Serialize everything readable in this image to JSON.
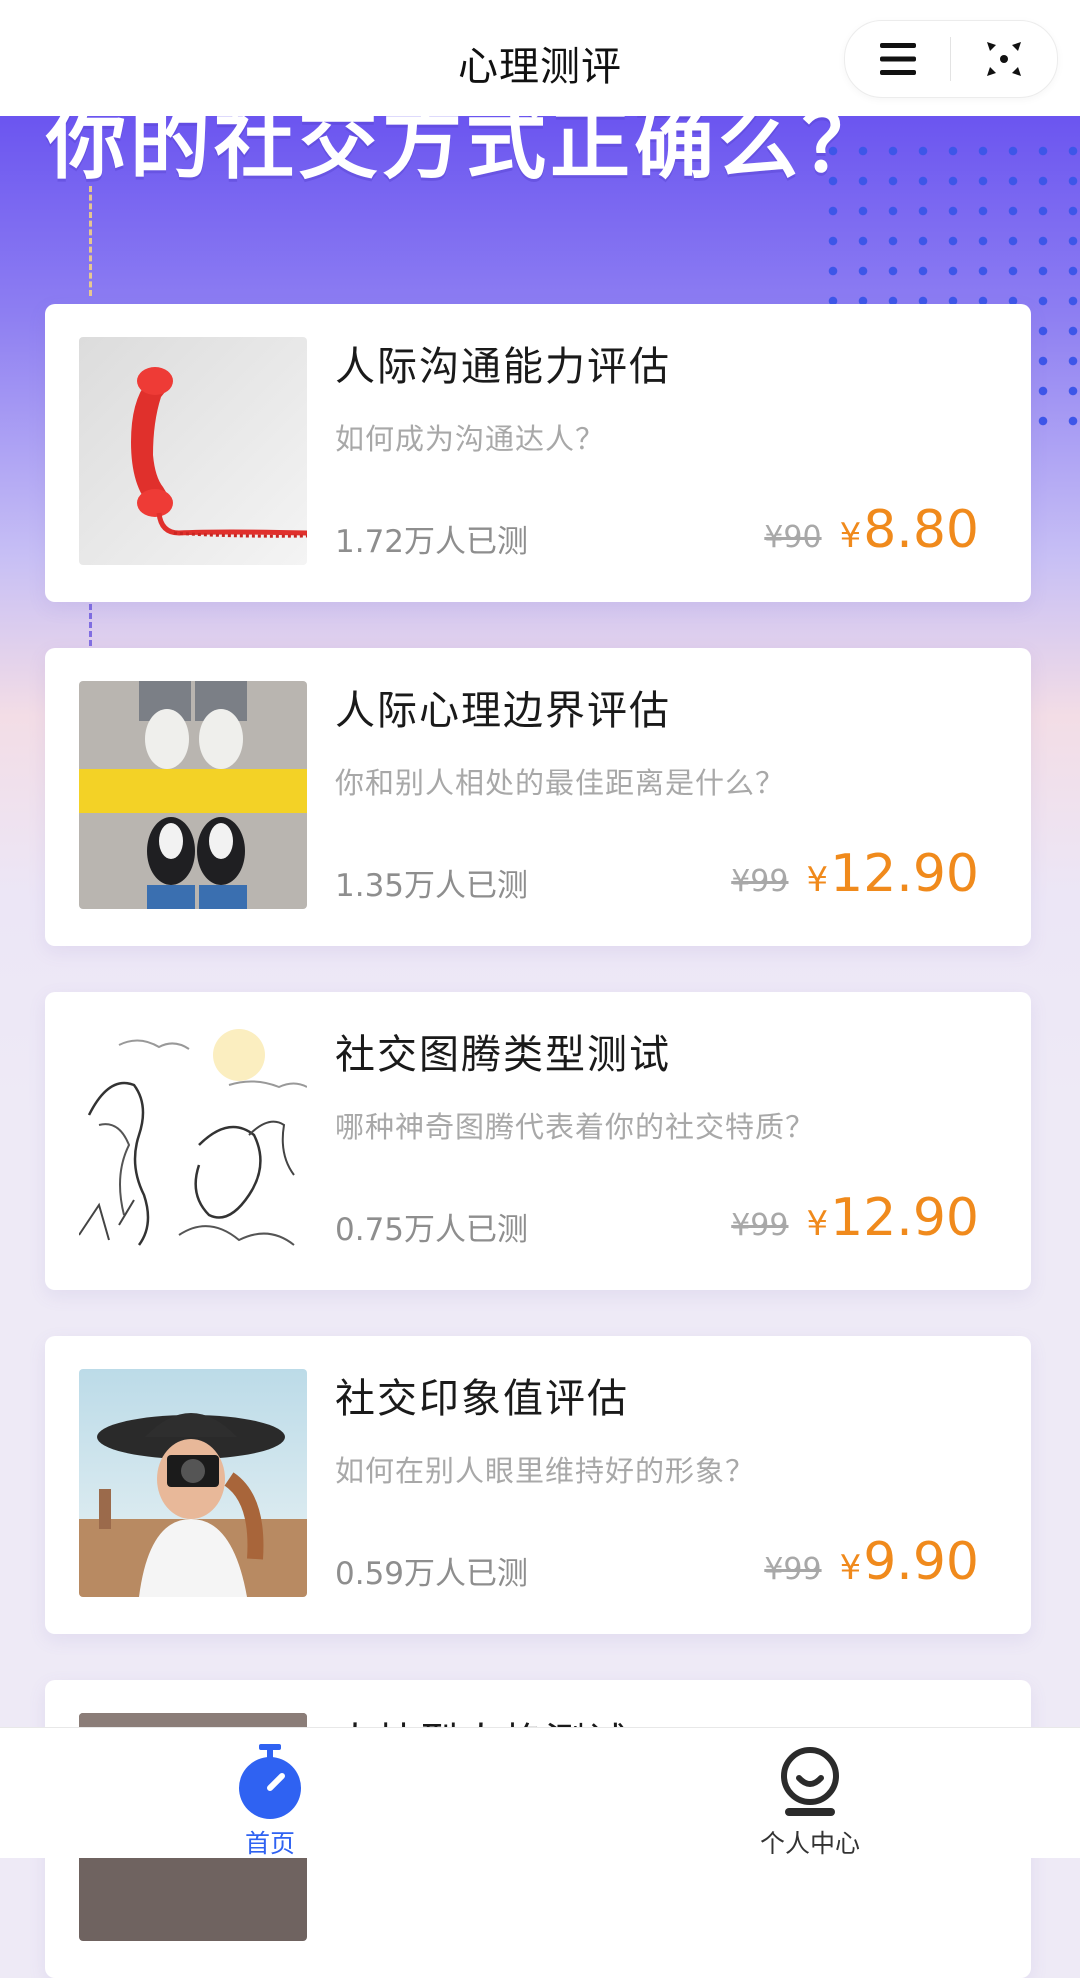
{
  "header": {
    "title": "心理测评",
    "menu_icon": "hamburger-menu-icon",
    "close_icon": "close-target-icon"
  },
  "hero": {
    "title": "你的社交方式正确么？"
  },
  "cards": [
    {
      "title": "人际沟通能力评估",
      "subtitle": "如何成为沟通达人？",
      "count": "1.72万人已测",
      "old_price": "¥90",
      "new_price_symbol": "¥",
      "new_price": "8.80",
      "image": "red-telephone-handset"
    },
    {
      "title": "人际心理边界评估",
      "subtitle": "你和别人相处的最佳距离是什么？",
      "count": "1.35万人已测",
      "old_price": "¥99",
      "new_price_symbol": "¥",
      "new_price": "12.90",
      "image": "shoes-yellow-line"
    },
    {
      "title": "社交图腾类型测试",
      "subtitle": "哪种神奇图腾代表着你的社交特质？",
      "count": "0.75万人已测",
      "old_price": "¥99",
      "new_price_symbol": "¥",
      "new_price": "12.90",
      "image": "dragon-phoenix-sketch"
    },
    {
      "title": "社交印象值评估",
      "subtitle": "如何在别人眼里维持好的形象？",
      "count": "0.59万人已测",
      "old_price": "¥99",
      "new_price_symbol": "¥",
      "new_price": "9.90",
      "image": "woman-with-camera"
    },
    {
      "title": "大扶型人格测试",
      "subtitle": "",
      "count": "",
      "old_price": "",
      "new_price_symbol": "",
      "new_price": "",
      "image": "partial-photo"
    }
  ],
  "tabbar": {
    "tabs": [
      {
        "label": "首页",
        "icon": "stopwatch-icon",
        "active": true
      },
      {
        "label": "个人中心",
        "icon": "user-center-icon",
        "active": false
      }
    ]
  },
  "colors": {
    "accent_blue": "#2f62f2",
    "price_orange": "#f08a1c",
    "hero_purple": "#6b55f0"
  }
}
